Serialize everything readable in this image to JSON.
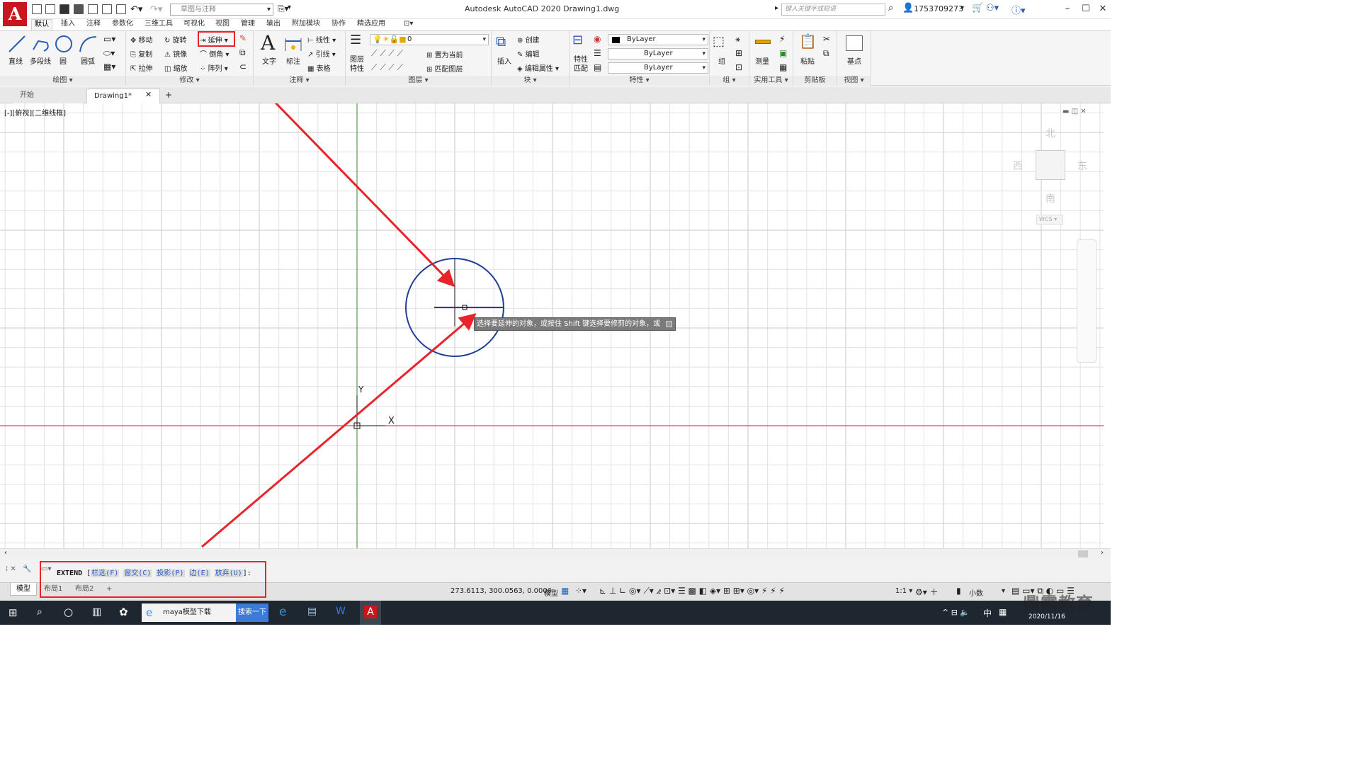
{
  "titlebar": {
    "app_letter": "A",
    "workspace": "草图与注释",
    "title": "Autodesk AutoCAD 2020    Drawing1.dwg",
    "search_placeholder": "键入关键字或短语",
    "user": "1753709273"
  },
  "menu_tabs": [
    "默认",
    "插入",
    "注释",
    "参数化",
    "三维工具",
    "可视化",
    "视图",
    "管理",
    "输出",
    "附加模块",
    "协作",
    "精选应用"
  ],
  "ribbon": {
    "draw": {
      "title": "绘图",
      "line": "直线",
      "polyline": "多段线",
      "circle": "圆",
      "arc": "圆弧"
    },
    "modify": {
      "title": "修改",
      "move": "移动",
      "rotate": "旋转",
      "extend": "延伸",
      "copy": "复制",
      "mirror": "镜像",
      "fillet": "倒角",
      "stretch": "拉伸",
      "scale": "缩放",
      "array": "阵列"
    },
    "annotation": {
      "title": "注释",
      "text": "文字",
      "dimension": "标注",
      "linear": "线性",
      "leader": "引线",
      "table": "表格"
    },
    "layers": {
      "title": "图层",
      "properties": "图层\n特性",
      "current_layer": "0",
      "set_current": "置为当前",
      "match_layer": "匹配图层"
    },
    "block": {
      "title": "块",
      "insert": "插入",
      "create": "创建",
      "edit": "编辑",
      "edit_attr": "编辑属性"
    },
    "properties": {
      "title": "特性",
      "match": "特性\n匹配",
      "color": "ByLayer",
      "linetype": "ByLayer",
      "lineweight": "ByLayer"
    },
    "groups": {
      "title": "组",
      "group": "组"
    },
    "utilities": {
      "title": "实用工具",
      "measure": "测量"
    },
    "clipboard": {
      "title": "剪贴板",
      "paste": "粘贴"
    },
    "view": {
      "title": "视图",
      "base": "基点"
    }
  },
  "file_tabs": {
    "start": "开始",
    "drawing": "Drawing1*"
  },
  "viewport": {
    "label": "[-][俯视][二维线框]",
    "tooltip": "选择要延伸的对象，或按住 Shift 键选择要修剪的对象，或",
    "ucs_x": "X",
    "ucs_y": "Y",
    "viewcube": {
      "north": "北",
      "south": "南",
      "east": "东",
      "west": "西",
      "wcs": "WCS"
    }
  },
  "command": {
    "name": "EXTEND",
    "options": [
      {
        "label": "栏选",
        "key": "F"
      },
      {
        "label": "窗交",
        "key": "C"
      },
      {
        "label": "投影",
        "key": "P"
      },
      {
        "label": "边",
        "key": "E"
      },
      {
        "label": "放弃",
        "key": "U"
      }
    ]
  },
  "layout_tabs": [
    "模型",
    "布局1",
    "布局2"
  ],
  "status": {
    "coords": "273.6113, 300.0563, 0.0000",
    "model": "模型",
    "scale": "1:1",
    "units": "小数"
  },
  "taskbar": {
    "maya": "maya模型下载",
    "search_btn": "搜索一下",
    "ime": "中",
    "date": "2020/11/16"
  },
  "watermark": "鼎霧教育",
  "colors": {
    "accent_red": "#e8242a",
    "autocad_red": "#c8161d",
    "circle_blue": "#1f3d99"
  }
}
